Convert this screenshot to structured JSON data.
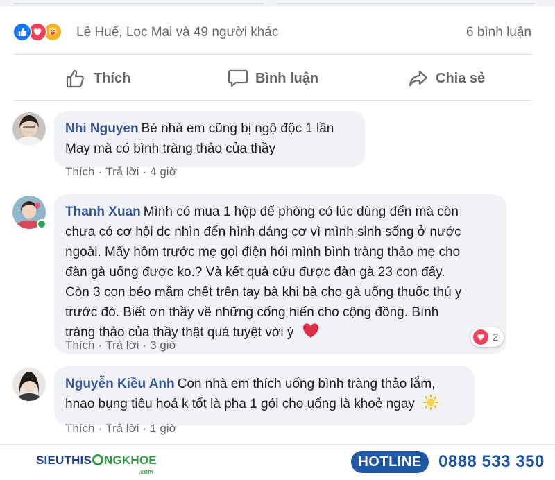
{
  "post": {
    "reaction_names": "Lê Huế, Loc Mai và 49 người khác",
    "comment_count": "6 bình luận",
    "reaction_icons": [
      "like-icon",
      "love-icon",
      "care-icon"
    ]
  },
  "actions": {
    "like_label": "Thích",
    "comment_label": "Bình luận",
    "share_label": "Chia sẻ"
  },
  "comments": [
    {
      "author": "Nhi Nguyen",
      "lines": [
        "Bé nhà em cũng bị ngộ độc 1 lần",
        "May mà có bình tràng thảo của thầy"
      ],
      "like_label": "Thích",
      "reply_label": "Trả lời",
      "time": "4 giờ"
    },
    {
      "author": "Thanh Xuan",
      "lines": [
        "Mình có mua 1 hộp để phòng có lúc dùng đến mà còn",
        "chưa có cơ hội dc nhìn đến hình dáng cơ vì mình sinh sống ở nước",
        "ngoài. Mấy hôm trước mẹ gọi điện hỏi mình bình tràng thảo mẹ cho",
        "đàn gà uống được ko.? Và kết quả cứu được đàn gà 23 con đấy.",
        "Còn 3 con béo mầm chết trên tay bà khi bà cho gà uống thuốc thú y",
        "trước đó. Biết ơn thầy về những cống hiến cho cộng đồng. Bình",
        "tràng thảo của thầy thật quá tuyệt vời ý"
      ],
      "like_label": "Thích",
      "reply_label": "Trả lời",
      "time": "3 giờ",
      "reaction_count": "2"
    },
    {
      "author": "Nguyễn Kiều Anh",
      "lines": [
        "Con nhà em thích uống bình tràng thảo lắm,",
        "hnao bụng tiêu hoá k tốt là pha 1 gói cho uống là khoẻ ngay"
      ],
      "like_label": "Thích",
      "reply_label": "Trả lời",
      "time": "1 giờ"
    }
  ],
  "footer": {
    "logo_part1": "SIEUTHIS",
    "logo_part2": "NGKHOE",
    "logo_sub": ".com",
    "hotline_label": "HOTLINE",
    "hotline_number": "0888 533 350"
  },
  "colors": {
    "facebook_blue": "#1877f2",
    "author_blue": "#385898",
    "love_red": "#f33e58",
    "brand_blue": "#1d57a3",
    "brand_green": "#2e9b3c"
  }
}
